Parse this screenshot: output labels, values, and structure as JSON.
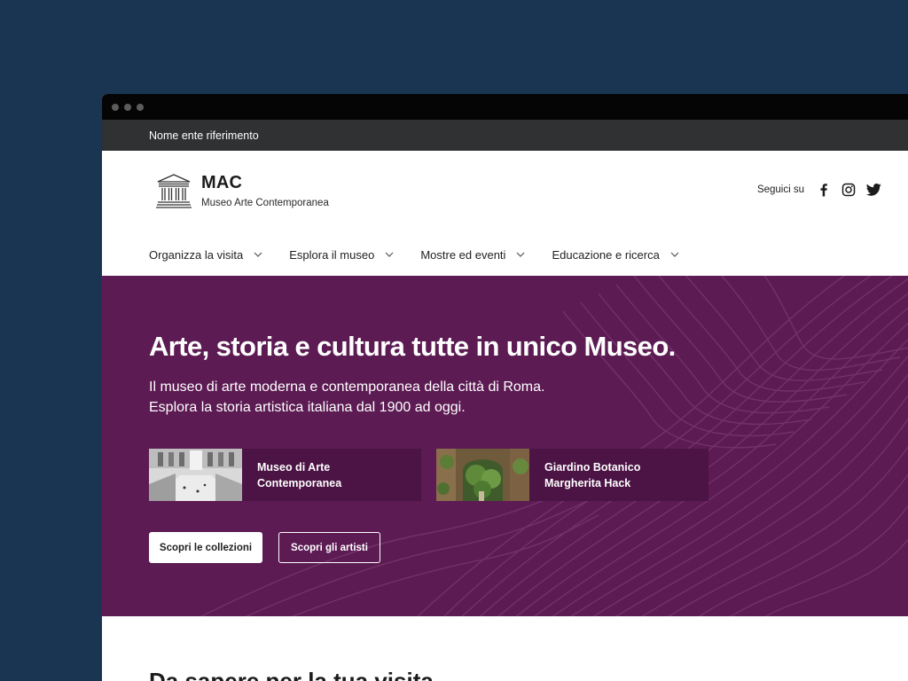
{
  "slim_header": {
    "label": "Nome ente riferimento"
  },
  "brand": {
    "title": "MAC",
    "subtitle": "Museo Arte Contemporanea",
    "icon": "museum-icon"
  },
  "social": {
    "label": "Seguici su",
    "icons": [
      "facebook-icon",
      "instagram-icon",
      "twitter-icon"
    ]
  },
  "nav": {
    "items": [
      {
        "label": "Organizza la visita"
      },
      {
        "label": "Esplora il museo"
      },
      {
        "label": "Mostre ed eventi"
      },
      {
        "label": "Educazione e ricerca"
      }
    ]
  },
  "hero": {
    "title": "Arte, storia e cultura tutte in unico Museo.",
    "text_line1": "Il museo di arte moderna e contemporanea della città di Roma.",
    "text_line2": "Esplora la storia artistica italiana dal 1900 ad oggi.",
    "cards": [
      {
        "label": "Museo di Arte Contemporanea"
      },
      {
        "label": "Giardino Botanico Margherita Hack"
      }
    ],
    "buttons": {
      "primary": "Scopri le collezioni",
      "secondary": "Scopri gli artisti"
    }
  },
  "section": {
    "title": "Da sapere per la tua visita"
  },
  "colors": {
    "backdrop": "#1a3552",
    "slim_header": "#2f3133",
    "hero": "#5c1b53",
    "card": "#4b1444"
  }
}
